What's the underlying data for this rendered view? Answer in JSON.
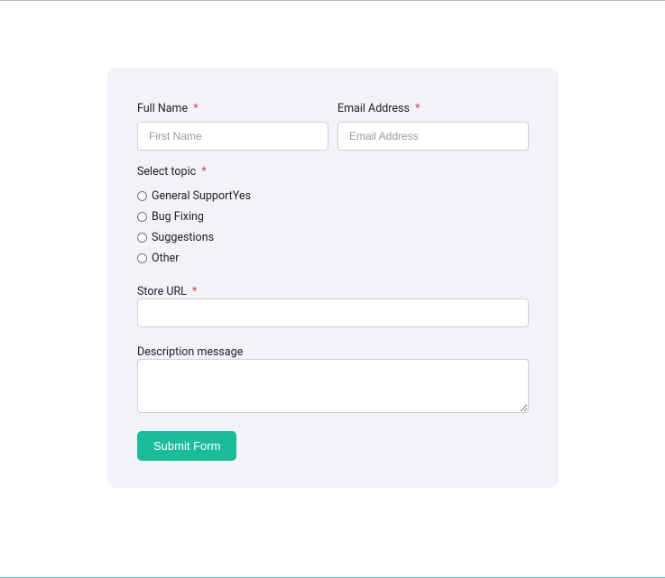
{
  "form": {
    "fullName": {
      "label": "Full Name",
      "placeholder": "First Name",
      "value": ""
    },
    "email": {
      "label": "Email Address",
      "placeholder": "Email Address",
      "value": ""
    },
    "topic": {
      "label": "Select topic",
      "options": [
        "General SupportYes",
        "Bug Fixing",
        "Suggestions",
        "Other"
      ]
    },
    "storeUrl": {
      "label": "Store URL",
      "value": ""
    },
    "description": {
      "label": "Description message",
      "value": ""
    },
    "submit": {
      "label": "Submit Form"
    },
    "asterisk": "*"
  }
}
